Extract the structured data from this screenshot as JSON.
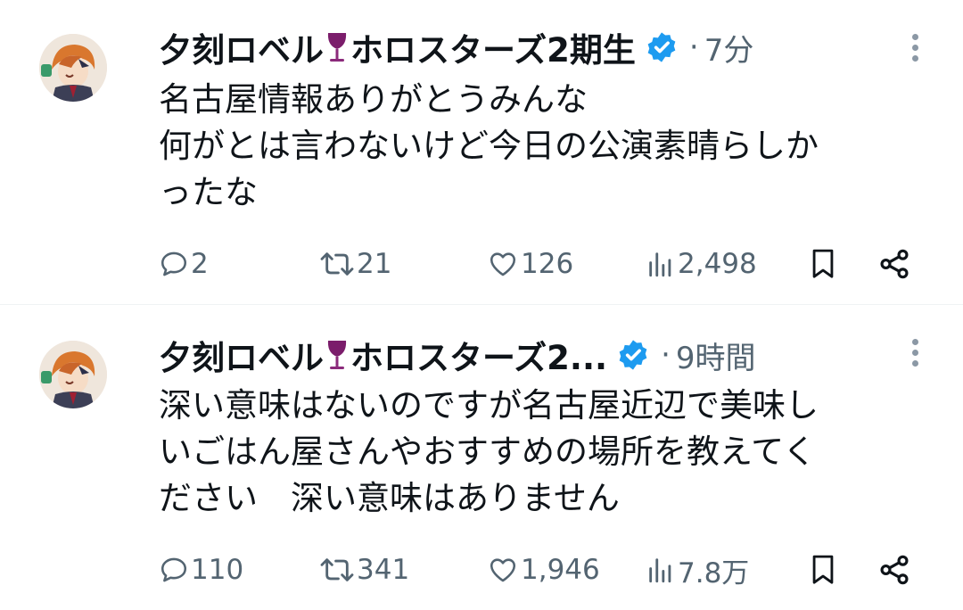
{
  "tweets": [
    {
      "display_name": "夕刻ロベル",
      "display_name_suffix": "ホロスターズ2期生",
      "time": "7分",
      "lines": [
        "名古屋情報ありがとうみんな",
        "何がとは言わないけど今日の公演素晴らしか",
        "ったな"
      ],
      "replies": "2",
      "retweets": "21",
      "likes": "126",
      "views": "2,498"
    },
    {
      "display_name": "夕刻ロベル",
      "display_name_suffix": "ホロスターズ2...",
      "time": "9時間",
      "lines": [
        "深い意味はないのですが名古屋近辺で美味し",
        "いごはん屋さんやおすすめの場所を教えてく",
        "ださい　深い意味はありません"
      ],
      "replies": "110",
      "retweets": "341",
      "likes": "1,946",
      "views": "7.8万"
    }
  ],
  "icons": {
    "name_emoji": "wine-glass-icon",
    "verified": "verified-badge-icon",
    "more": "more-vertical-icon",
    "reply": "reply-icon",
    "retweet": "retweet-icon",
    "like": "heart-icon",
    "views": "views-chart-icon",
    "bookmark": "bookmark-icon",
    "share": "share-icon"
  },
  "colors": {
    "verified": "#1d9bf0",
    "wine": "#7b1d6b",
    "muted": "#536471",
    "text": "#0f1419"
  }
}
